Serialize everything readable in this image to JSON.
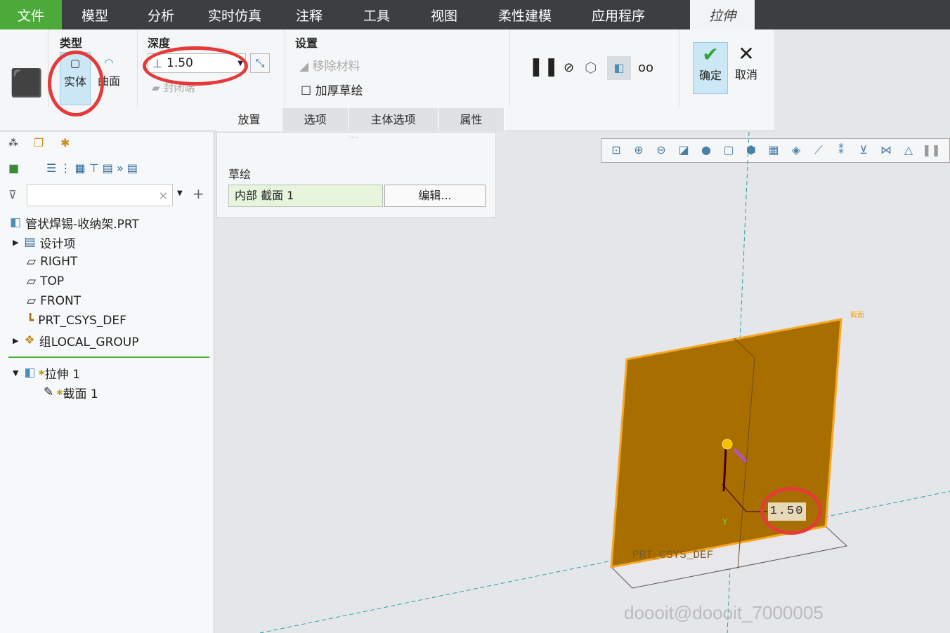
{
  "menu": {
    "items": [
      "文件",
      "模型",
      "分析",
      "实时仿真",
      "注释",
      "工具",
      "视图",
      "柔性建模",
      "应用程序",
      "拉伸"
    ]
  },
  "ribbon": {
    "type": {
      "title": "类型",
      "solid": "实体",
      "surface": "曲面"
    },
    "depth": {
      "title": "深度",
      "value": "1.50",
      "capped": "封闭端"
    },
    "settings": {
      "title": "设置",
      "remove": "移除材料",
      "thicken": "加厚草绘"
    },
    "ok": "确定",
    "cancel": "取消",
    "tabs": [
      "放置",
      "选项",
      "主体选项",
      "属性"
    ]
  },
  "placement": {
    "sketch_label": "草绘",
    "sketch_value": "内部 截面 1",
    "edit": "编辑..."
  },
  "tree": {
    "search_placeholder": "",
    "items": [
      {
        "label": "管状焊锡-收纳架.PRT"
      },
      {
        "label": "设计项"
      },
      {
        "label": "RIGHT"
      },
      {
        "label": "TOP"
      },
      {
        "label": "FRONT"
      },
      {
        "label": "PRT_CSYS_DEF"
      },
      {
        "label": "组LOCAL_GROUP"
      },
      {
        "label": "拉伸 1"
      },
      {
        "label": "截面 1"
      }
    ]
  },
  "viewport": {
    "dimension": "1.50",
    "csys_label": "PRT_CSYS_DEF",
    "section_label": "截面",
    "axis_y": "Y",
    "model_color": "#a86e00",
    "edge_color": "#f5a623"
  },
  "watermark": "doooit@doooit_7000005"
}
